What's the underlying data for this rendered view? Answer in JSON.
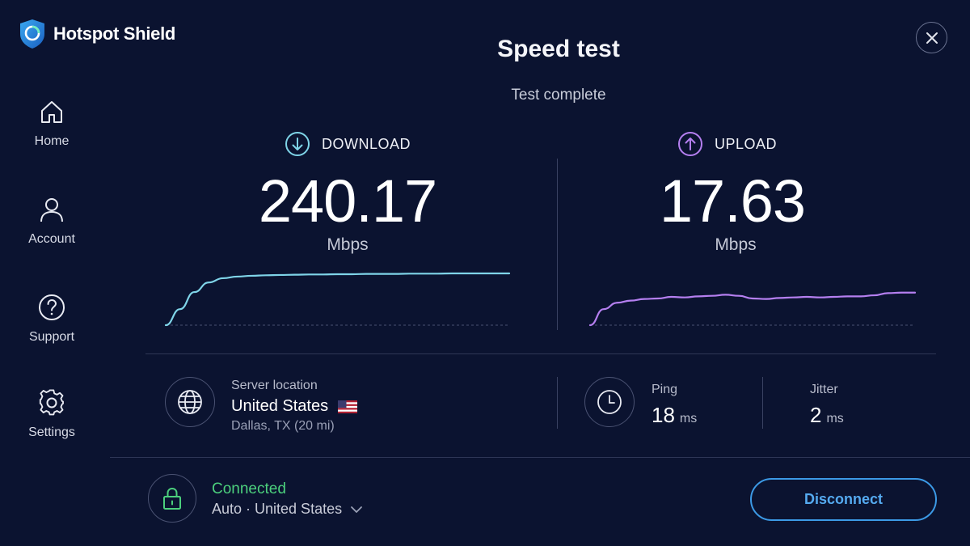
{
  "app": {
    "brand": "Hotspot Shield",
    "title": "Speed test",
    "status": "Test complete"
  },
  "sidebar": {
    "items": [
      {
        "label": "Home",
        "icon": "home-icon"
      },
      {
        "label": "Account",
        "icon": "user-icon"
      },
      {
        "label": "Support",
        "icon": "help-icon"
      },
      {
        "label": "Settings",
        "icon": "gear-icon"
      }
    ]
  },
  "download": {
    "label": "DOWNLOAD",
    "value": "240.17",
    "unit": "Mbps",
    "color": "#7fd4e8",
    "icon": "arrow-down-circle-icon",
    "chart_data": {
      "type": "line",
      "values": [
        0,
        30,
        62,
        80,
        88,
        91,
        92.5,
        93.5,
        94,
        94.5,
        95,
        95,
        95.5,
        95.5,
        96,
        96,
        96,
        96.5,
        96.5,
        96.5,
        97,
        97,
        97,
        97,
        97
      ]
    }
  },
  "upload": {
    "label": "UPLOAD",
    "value": "17.63",
    "unit": "Mbps",
    "color": "#b57ff0",
    "icon": "arrow-up-circle-icon",
    "chart_data": {
      "type": "line",
      "values": [
        0,
        30,
        42,
        46,
        49,
        50,
        53,
        52,
        54,
        55,
        57,
        55,
        50,
        49,
        51,
        52,
        53,
        52,
        53,
        54,
        54,
        56,
        60,
        61,
        61
      ]
    }
  },
  "server": {
    "label": "Server location",
    "country": "United States",
    "city": "Dallas, TX (20 mi)",
    "icon": "globe-icon"
  },
  "ping": {
    "label": "Ping",
    "value": "18",
    "unit": "ms",
    "icon": "clock-icon"
  },
  "jitter": {
    "label": "Jitter",
    "value": "2",
    "unit": "ms"
  },
  "connection": {
    "status": "Connected",
    "location": "Auto · United States",
    "icon": "lock-icon",
    "status_color": "#4cd07d"
  },
  "disconnect_label": "Disconnect"
}
